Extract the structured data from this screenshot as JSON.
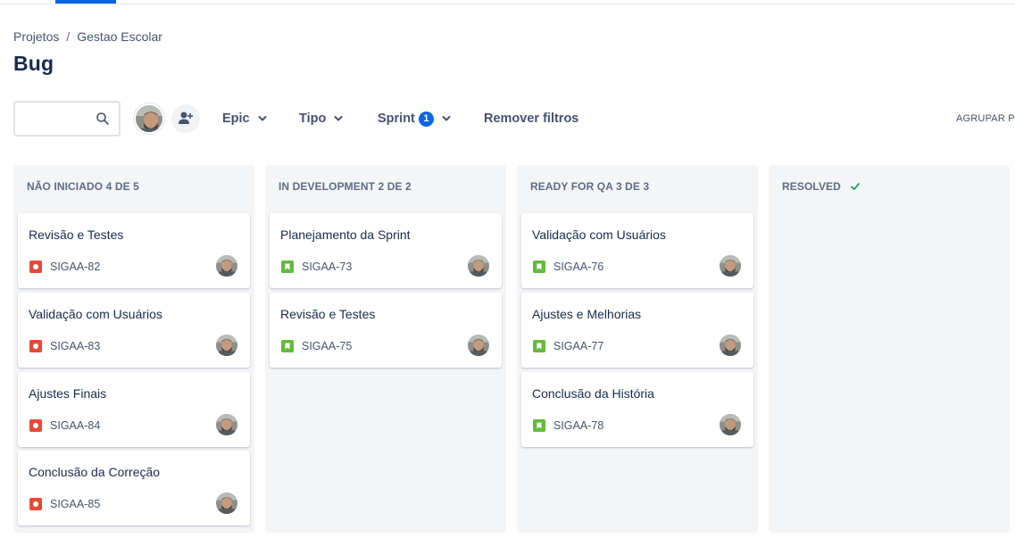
{
  "breadcrumb": {
    "projects": "Projetos",
    "separator": "/",
    "project": "Gestao Escolar"
  },
  "page_title": "Bug",
  "toolbar": {
    "search_placeholder": "",
    "filters": {
      "epic": "Epic",
      "tipo": "Tipo",
      "sprint": "Sprint",
      "sprint_count": "1",
      "remove": "Remover filtros"
    },
    "group_by": "AGRUPAR PO"
  },
  "columns": [
    {
      "title": "NÃO INICIADO 4 DE 5",
      "cards": [
        {
          "summary": "Revisão e Testes",
          "key": "SIGAA-82",
          "type": "bug"
        },
        {
          "summary": "Validação com Usuários",
          "key": "SIGAA-83",
          "type": "bug"
        },
        {
          "summary": "Ajustes Finais",
          "key": "SIGAA-84",
          "type": "bug"
        },
        {
          "summary": "Conclusão da Correção",
          "key": "SIGAA-85",
          "type": "bug"
        }
      ]
    },
    {
      "title": "IN DEVELOPMENT 2 DE 2",
      "cards": [
        {
          "summary": "Planejamento da Sprint",
          "key": "SIGAA-73",
          "type": "story"
        },
        {
          "summary": "Revisão e Testes",
          "key": "SIGAA-75",
          "type": "story"
        }
      ]
    },
    {
      "title": "READY FOR QA 3 DE 3",
      "cards": [
        {
          "summary": "Validação com Usuários",
          "key": "SIGAA-76",
          "type": "story"
        },
        {
          "summary": "Ajustes e Melhorias",
          "key": "SIGAA-77",
          "type": "story"
        },
        {
          "summary": "Conclusão da História",
          "key": "SIGAA-78",
          "type": "story"
        }
      ]
    },
    {
      "title": "RESOLVED",
      "done_icon": "check-icon",
      "cards": []
    }
  ],
  "colors": {
    "accent": "#0c66e4",
    "bug": "#e5493a",
    "story": "#63ba3c",
    "column_bg": "#f4f5f7",
    "check": "#22a06b"
  }
}
